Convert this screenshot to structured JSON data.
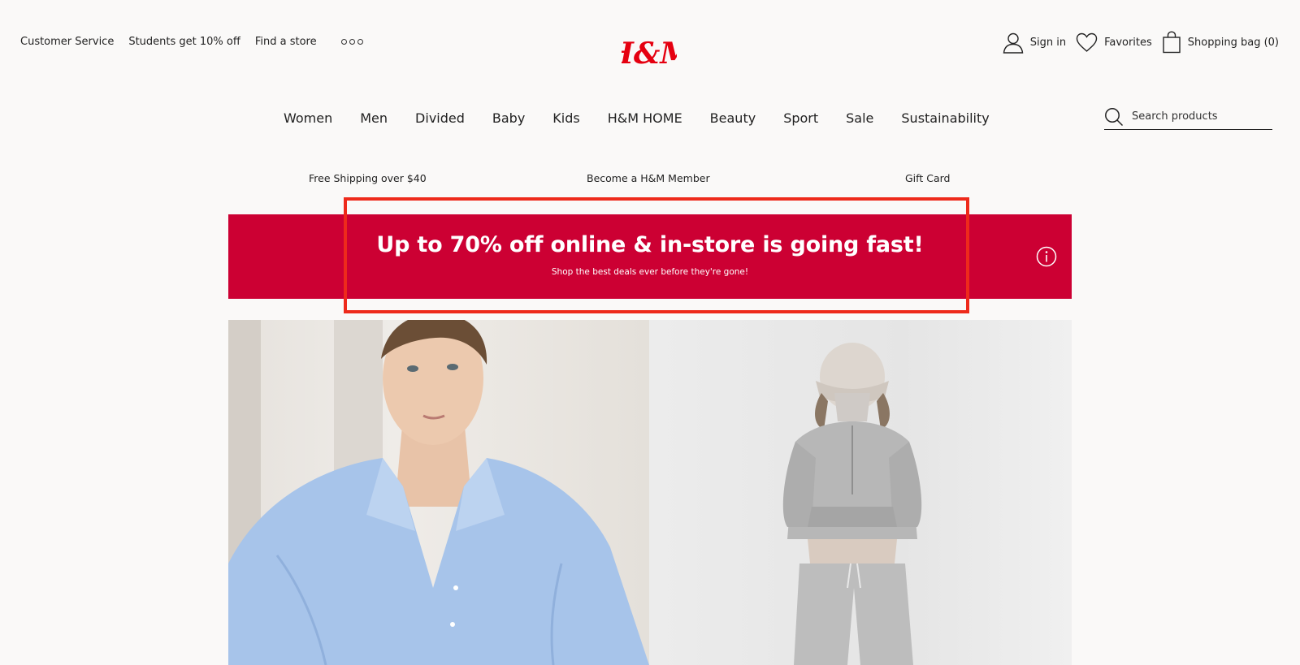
{
  "header": {
    "top_links": [
      "Customer Service",
      "Students get 10% off",
      "Find a store"
    ],
    "more_icon": "more-dots-icon",
    "logo_text": "H&M",
    "account": {
      "sign_in": "Sign in",
      "favorites": "Favorites",
      "shopping_bag": "Shopping bag (0)"
    }
  },
  "nav": {
    "items": [
      "Women",
      "Men",
      "Divided",
      "Baby",
      "Kids",
      "H&M HOME",
      "Beauty",
      "Sport",
      "Sale",
      "Sustainability"
    ]
  },
  "search": {
    "placeholder": "Search products",
    "value": ""
  },
  "promos": [
    "Free Shipping over $40",
    "Become a H&M Member",
    "Gift Card"
  ],
  "banner": {
    "title": "Up to 70% off online & in-store is going fast!",
    "subtitle": "Shop the best deals ever before they're gone!",
    "info_icon": "info-icon"
  },
  "colors": {
    "brand_red": "#cc0033",
    "logo_red": "#e50010",
    "highlight": "#ee2a1b",
    "page_bg": "#faf9f8"
  }
}
